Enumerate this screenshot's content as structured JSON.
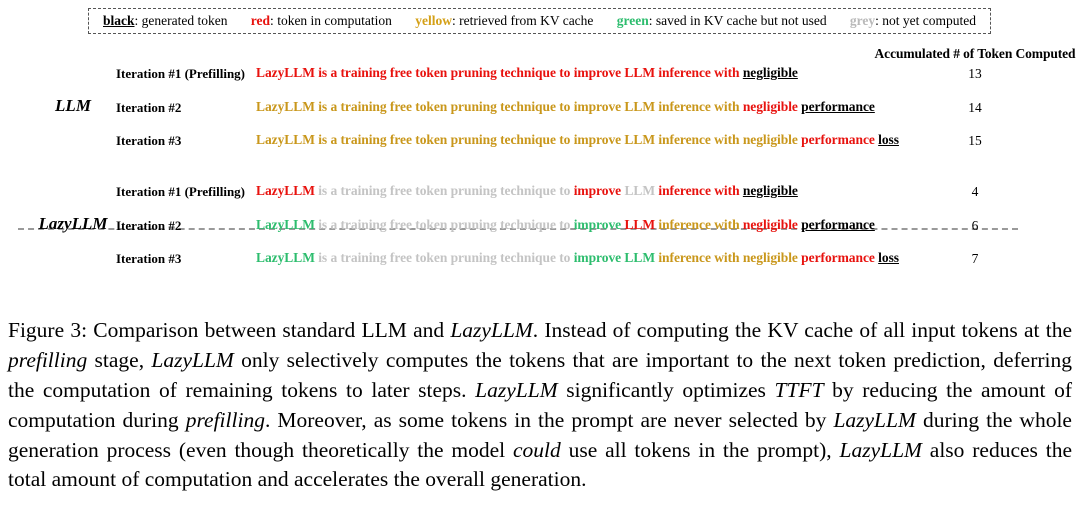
{
  "legend": {
    "items": [
      {
        "key": "black",
        "sep": ": ",
        "desc": "generated token",
        "color": "#000000",
        "style": "underline"
      },
      {
        "key": "red",
        "sep": ": ",
        "desc": "token in computation",
        "color": "#e8120e",
        "style": "plain"
      },
      {
        "key": "yellow",
        "sep": ": ",
        "desc": "retrieved from KV cache",
        "color": "#d4a017",
        "style": "plain"
      },
      {
        "key": "green",
        "sep": ": ",
        "desc": "saved in KV cache but not used",
        "color": "#2dbd6e",
        "style": "plain"
      },
      {
        "key": "grey",
        "sep": ": ",
        "desc": "not yet computed",
        "color": "#b9b9b9",
        "style": "plain"
      }
    ]
  },
  "table": {
    "count_column_header": "Accumulated # of Token Computed",
    "groups": [
      {
        "label": "LLM",
        "rows": [
          {
            "iteration": "Iteration #1 (Prefilling)",
            "count": "13",
            "segments": [
              {
                "text": "LazyLLM is a training free token pruning technique to improve LLM inference with ",
                "color": "red"
              },
              {
                "text": "negligible",
                "color": "black",
                "underline": true
              }
            ]
          },
          {
            "iteration": "Iteration #2",
            "count": "14",
            "segments": [
              {
                "text": "LazyLLM is a training free token pruning technique to improve LLM inference with ",
                "color": "yellow"
              },
              {
                "text": "negligible ",
                "color": "red"
              },
              {
                "text": "performance",
                "color": "black",
                "underline": true
              }
            ]
          },
          {
            "iteration": "Iteration #3",
            "count": "15",
            "segments": [
              {
                "text": "LazyLLM is a training free token pruning technique to improve LLM inference with negligible ",
                "color": "yellow"
              },
              {
                "text": "performance ",
                "color": "red"
              },
              {
                "text": "loss",
                "color": "black",
                "underline": true
              }
            ]
          }
        ]
      },
      {
        "label": "LazyLLM",
        "rows": [
          {
            "iteration": "Iteration #1 (Prefilling)",
            "count": "4",
            "segments": [
              {
                "text": "LazyLLM ",
                "color": "red"
              },
              {
                "text": "is a training free token pruning technique to ",
                "color": "grey"
              },
              {
                "text": "improve ",
                "color": "red"
              },
              {
                "text": "LLM ",
                "color": "grey"
              },
              {
                "text": "inference with ",
                "color": "red"
              },
              {
                "text": "negligible",
                "color": "black",
                "underline": true
              }
            ]
          },
          {
            "iteration": "Iteration #2",
            "count": "6",
            "segments": [
              {
                "text": "LazyLLM ",
                "color": "green"
              },
              {
                "text": "is a training free token pruning technique to ",
                "color": "grey"
              },
              {
                "text": "improve ",
                "color": "green"
              },
              {
                "text": "LLM ",
                "color": "red"
              },
              {
                "text": "inference with ",
                "color": "yellow"
              },
              {
                "text": "negligible ",
                "color": "red"
              },
              {
                "text": "performance",
                "color": "black",
                "underline": true
              }
            ]
          },
          {
            "iteration": "Iteration #3",
            "count": "7",
            "segments": [
              {
                "text": "LazyLLM ",
                "color": "green"
              },
              {
                "text": "is a training free token pruning technique to ",
                "color": "grey"
              },
              {
                "text": "improve LLM ",
                "color": "green"
              },
              {
                "text": "inference with negligible ",
                "color": "yellow"
              },
              {
                "text": "performance ",
                "color": "red"
              },
              {
                "text": "loss",
                "color": "black",
                "underline": true
              }
            ]
          }
        ]
      }
    ]
  },
  "caption": {
    "parts": [
      {
        "text": "Figure 3: Comparison between standard LLM and ",
        "italic": false
      },
      {
        "text": "LazyLLM",
        "italic": true
      },
      {
        "text": ". Instead of computing the KV cache of all input tokens at the ",
        "italic": false
      },
      {
        "text": "prefilling",
        "italic": true
      },
      {
        "text": " stage, ",
        "italic": false
      },
      {
        "text": "LazyLLM",
        "italic": true
      },
      {
        "text": " only selectively computes the tokens that are important to the next token prediction, deferring the computation of remaining tokens to later steps. ",
        "italic": false
      },
      {
        "text": "LazyLLM",
        "italic": true
      },
      {
        "text": " significantly optimizes ",
        "italic": false
      },
      {
        "text": "TTFT",
        "italic": true
      },
      {
        "text": " by reducing the amount of computation during ",
        "italic": false
      },
      {
        "text": "prefilling",
        "italic": true
      },
      {
        "text": ". Moreover, as some tokens in the prompt are never selected by ",
        "italic": false
      },
      {
        "text": "LazyLLM",
        "italic": true
      },
      {
        "text": " during the whole generation process (even though theoretically the model ",
        "italic": false
      },
      {
        "text": "could",
        "italic": true
      },
      {
        "text": " use all tokens in the prompt), ",
        "italic": false
      },
      {
        "text": "LazyLLM",
        "italic": true
      },
      {
        "text": " also reduces the total amount of computation and accelerates the overall generation.",
        "italic": false
      }
    ]
  },
  "colors": {
    "black": "#000000",
    "red": "#e8120e",
    "yellow": "#c9971b",
    "green": "#2dbd6e",
    "grey": "#c4c4c4",
    "divider": "#9a9a9a"
  }
}
